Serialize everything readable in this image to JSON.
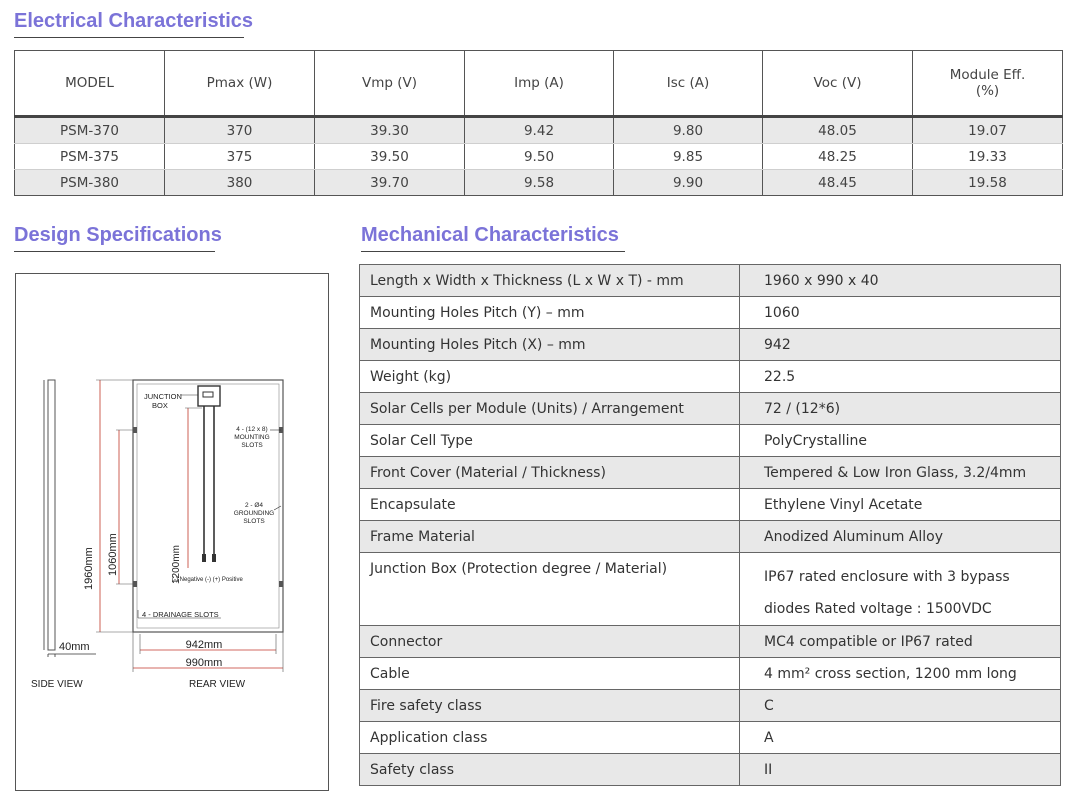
{
  "electrical": {
    "title": "Electrical Characteristics",
    "headers": [
      "MODEL",
      "Pmax (W)",
      "Vmp (V)",
      "Imp (A)",
      "Isc (A)",
      "Voc (V)",
      "Module Eff. (%)"
    ],
    "rows": [
      [
        "PSM-370",
        "370",
        "39.30",
        "9.42",
        "9.80",
        "48.05",
        "19.07"
      ],
      [
        "PSM-375",
        "375",
        "39.50",
        "9.50",
        "9.85",
        "48.25",
        "19.33"
      ],
      [
        "PSM-380",
        "380",
        "39.70",
        "9.58",
        "9.90",
        "48.45",
        "19.58"
      ]
    ]
  },
  "design": {
    "title": "Design Specifications",
    "labels": {
      "junction_box": "JUNCTION BOX",
      "mounting_slots": "4 - (12 x 8) MOUNTING SLOTS",
      "grounding_slots": "2 - Ø4 GROUNDING SLOTS",
      "negative_positive": "(-) Negative (-) (+) Positive",
      "drainage_slots": "4 - DRAINAGE SLOTS",
      "dim_1960": "1960mm",
      "dim_1060": "1060mm",
      "dim_1200": "1200mm",
      "dim_40": "40mm",
      "dim_942": "942mm",
      "dim_990": "990mm",
      "side_view": "SIDE VIEW",
      "rear_view": "REAR VIEW"
    }
  },
  "mechanical": {
    "title": "Mechanical Characteristics",
    "rows": [
      {
        "label": "Length x Width x Thickness (L x W x T) - mm",
        "value": "1960 x 990 x 40"
      },
      {
        "label": "Mounting Holes Pitch (Y) – mm",
        "value": "1060"
      },
      {
        "label": "Mounting Holes Pitch (X) – mm",
        "value": "942"
      },
      {
        "label": "Weight (kg)",
        "value": "22.5"
      },
      {
        "label": "Solar Cells per Module (Units) / Arrangement",
        "value": "72 / (12*6)"
      },
      {
        "label": "Solar Cell Type",
        "value": "PolyCrystalline"
      },
      {
        "label": "Front Cover (Material / Thickness)",
        "value": "Tempered & Low Iron Glass, 3.2/4mm"
      },
      {
        "label": "Encapsulate",
        "value": "Ethylene Vinyl Acetate"
      },
      {
        "label": "Frame Material",
        "value": "Anodized Aluminum Alloy"
      },
      {
        "label": "Junction Box (Protection degree / Material)",
        "value": "IP67 rated enclosure with 3 bypass diodes Rated voltage : 1500VDC"
      },
      {
        "label": "Connector",
        "value": "MC4 compatible or IP67 rated"
      },
      {
        "label": "Cable",
        "value": "4 mm² cross section, 1200 mm long"
      },
      {
        "label": "Fire safety class",
        "value": "C"
      },
      {
        "label": "Application class",
        "value": "A"
      },
      {
        "label": "Safety class",
        "value": "II"
      }
    ]
  }
}
